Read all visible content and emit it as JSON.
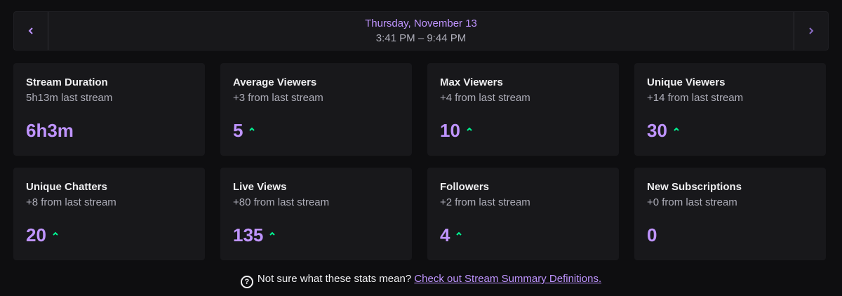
{
  "header": {
    "date": "Thursday, November 13",
    "time_range": "3:41 PM – 9:44 PM",
    "prev_icon": "chevron-left-icon",
    "next_icon": "chevron-right-icon"
  },
  "colors": {
    "accent": "#bf94ff",
    "up_green": "#00f593",
    "card_bg": "#18181b",
    "page_bg": "#0e0e10"
  },
  "stats": [
    {
      "title": "Stream Duration",
      "sub": "5h13m last stream",
      "value": "6h3m",
      "trend": "none"
    },
    {
      "title": "Average Viewers",
      "sub": "+3 from last stream",
      "value": "5",
      "trend": "up"
    },
    {
      "title": "Max Viewers",
      "sub": "+4 from last stream",
      "value": "10",
      "trend": "up"
    },
    {
      "title": "Unique Viewers",
      "sub": "+14 from last stream",
      "value": "30",
      "trend": "up"
    },
    {
      "title": "Unique Chatters",
      "sub": "+8 from last stream",
      "value": "20",
      "trend": "up"
    },
    {
      "title": "Live Views",
      "sub": "+80 from last stream",
      "value": "135",
      "trend": "up"
    },
    {
      "title": "Followers",
      "sub": "+2 from last stream",
      "value": "4",
      "trend": "up"
    },
    {
      "title": "New Subscriptions",
      "sub": "+0 from last stream",
      "value": "0",
      "trend": "none"
    }
  ],
  "footer": {
    "help_icon": "question-circle-icon",
    "text": "Not sure what these stats mean?",
    "link": "Check out Stream Summary Definitions."
  }
}
